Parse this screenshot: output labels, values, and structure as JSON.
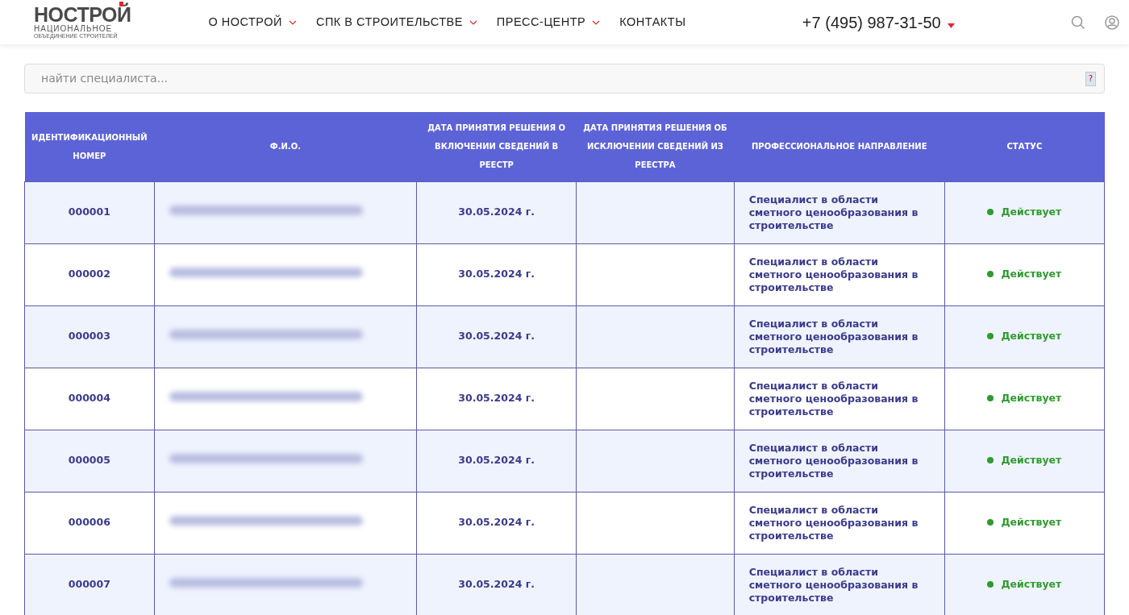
{
  "logo": {
    "title": "НОСТРОЙ",
    "subtitle": "НАЦИОНАЛЬНОЕ",
    "tagline": "ОБЪЕДИНЕНИЕ СТРОИТЕЛЕЙ"
  },
  "nav": [
    {
      "label": "О НОСТРОЙ",
      "has_menu": true
    },
    {
      "label": "СПК В СТРОИТЕЛЬСТВЕ",
      "has_menu": true
    },
    {
      "label": "ПРЕСС-ЦЕНТР",
      "has_menu": true
    },
    {
      "label": "КОНТАКТЫ",
      "has_menu": false
    }
  ],
  "phone": "+7 (495) 987-31-50",
  "search": {
    "placeholder": "найти специалиста...",
    "help": "?"
  },
  "table": {
    "columns": [
      "ИДЕНТИФИКАЦИОННЫЙ НОМЕР",
      "Ф.И.О.",
      "ДАТА ПРИНЯТИЯ РЕШЕНИЯ О ВКЛЮЧЕНИИ СВЕДЕНИЙ В РЕЕСТР",
      "ДАТА ПРИНЯТИЯ РЕШЕНИЯ ОБ ИСКЛЮЧЕНИИ СВЕДЕНИЙ ИЗ РЕЕСТРА",
      "ПРОФЕССИОНАЛЬНОЕ НАПРАВЛЕНИЕ",
      "СТАТУС"
    ],
    "rows": [
      {
        "id": "000001",
        "name_redacted": true,
        "included": "30.05.2024 г.",
        "direction": "Специалист в области сметного ценообразования в строительстве",
        "status": "Действует",
        "color": "#2e9b2e"
      },
      {
        "id": "000002",
        "name_redacted": true,
        "included": "30.05.2024 г.",
        "direction": "Специалист в области сметного ценообразования в строительстве",
        "status": "Действует",
        "color": "#2e9b2e"
      },
      {
        "id": "000003",
        "name_redacted": true,
        "included": "30.05.2024 г.",
        "direction": "Специалист в области сметного ценообразования в строительстве",
        "status": "Действует",
        "color": "#2e9b2e"
      },
      {
        "id": "000004",
        "name_redacted": true,
        "included": "30.05.2024 г.",
        "direction": "Специалист в области сметного ценообразования в строительстве",
        "status": "Действует",
        "color": "#2e9b2e"
      },
      {
        "id": "000005",
        "name_redacted": true,
        "included": "30.05.2024 г.",
        "direction": "Специалист в области сметного ценообразования в строительстве",
        "status": "Действует",
        "color": "#2e9b2e"
      },
      {
        "id": "000006",
        "name_redacted": true,
        "included": "30.05.2024 г.",
        "direction": "Специалист в области сметного ценообразования в строительстве",
        "status": "Действует",
        "color": "#2e9b2e"
      },
      {
        "id": "000007",
        "name_redacted": true,
        "included": "30.05.2024 г.",
        "direction": "Специалист в области сметного ценообразования в строительстве",
        "status": "Действует",
        "color": "#2e9b2e"
      }
    ]
  }
}
